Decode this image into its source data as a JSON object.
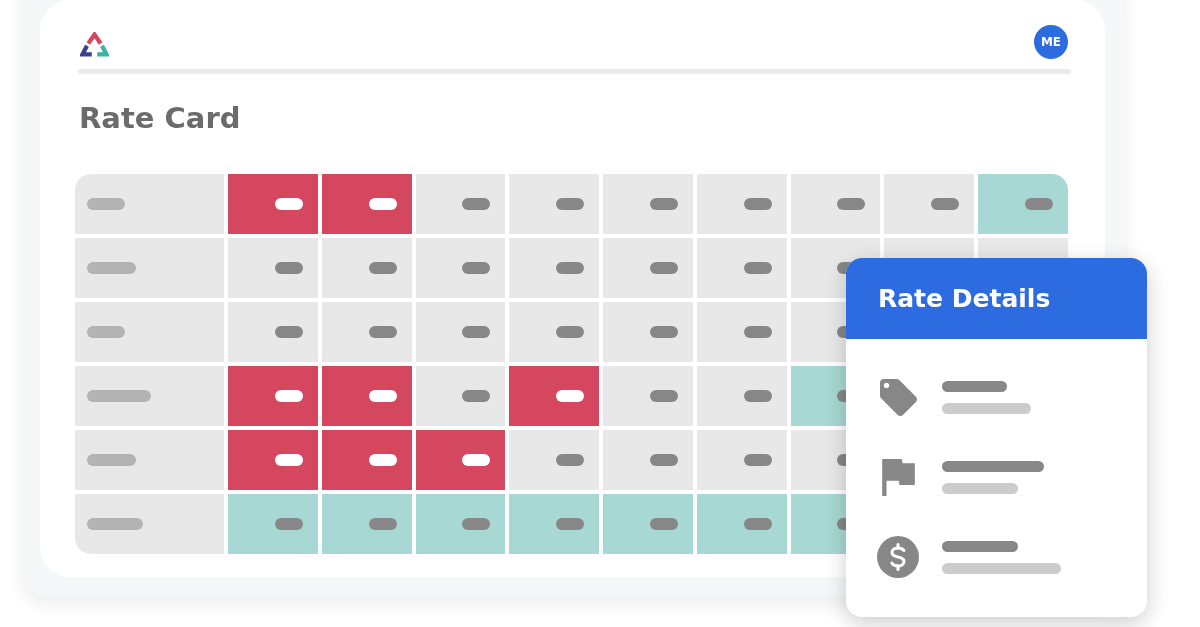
{
  "header": {
    "avatar": {
      "initials": "ME"
    }
  },
  "title": "Rate Card",
  "rate_grid": {
    "rows": [
      {
        "cells": [
          {
            "kind": "value",
            "color": "#d4475f"
          },
          {
            "kind": "value",
            "color": "#d4475f"
          },
          {
            "kind": "value",
            "color": "#e8e8e8"
          },
          {
            "kind": "value",
            "color": "#e8e8e8"
          },
          {
            "kind": "value",
            "color": "#e8e8e8"
          },
          {
            "kind": "value",
            "color": "#e8e8e8"
          },
          {
            "kind": "value",
            "color": "#e8e8e8"
          },
          {
            "kind": "value",
            "color": "#e8e8e8"
          },
          {
            "kind": "value",
            "color": "#a8d8d3"
          }
        ]
      },
      {
        "cells": [
          {
            "kind": "value",
            "color": "#e8e8e8"
          },
          {
            "kind": "value",
            "color": "#e8e8e8"
          },
          {
            "kind": "value",
            "color": "#e8e8e8"
          },
          {
            "kind": "value",
            "color": "#e8e8e8"
          },
          {
            "kind": "value",
            "color": "#e8e8e8"
          },
          {
            "kind": "value",
            "color": "#e8e8e8"
          },
          {
            "kind": "value",
            "color": "#e8e8e8"
          },
          {
            "kind": "blank",
            "color": "#e8e8e8"
          },
          {
            "kind": "blank",
            "color": "#e8e8e8"
          }
        ]
      },
      {
        "cells": [
          {
            "kind": "value",
            "color": "#e8e8e8"
          },
          {
            "kind": "value",
            "color": "#e8e8e8"
          },
          {
            "kind": "value",
            "color": "#e8e8e8"
          },
          {
            "kind": "value",
            "color": "#e8e8e8"
          },
          {
            "kind": "value",
            "color": "#e8e8e8"
          },
          {
            "kind": "value",
            "color": "#e8e8e8"
          },
          {
            "kind": "value",
            "color": "#e8e8e8"
          }
        ]
      },
      {
        "cells": [
          {
            "kind": "value",
            "color": "#d4475f"
          },
          {
            "kind": "value",
            "color": "#d4475f"
          },
          {
            "kind": "value",
            "color": "#e8e8e8"
          },
          {
            "kind": "value",
            "color": "#d4475f"
          },
          {
            "kind": "value",
            "color": "#e8e8e8"
          },
          {
            "kind": "value",
            "color": "#e8e8e8"
          },
          {
            "kind": "value",
            "color": "#a8d8d3"
          }
        ]
      },
      {
        "cells": [
          {
            "kind": "value",
            "color": "#d4475f"
          },
          {
            "kind": "value",
            "color": "#d4475f"
          },
          {
            "kind": "value",
            "color": "#d4475f"
          },
          {
            "kind": "value",
            "color": "#e8e8e8"
          },
          {
            "kind": "value",
            "color": "#e8e8e8"
          },
          {
            "kind": "value",
            "color": "#e8e8e8"
          },
          {
            "kind": "value",
            "color": "#e8e8e8"
          }
        ]
      },
      {
        "cells": [
          {
            "kind": "value",
            "color": "#a8d8d3"
          },
          {
            "kind": "value",
            "color": "#a8d8d3"
          },
          {
            "kind": "value",
            "color": "#a8d8d3"
          },
          {
            "kind": "value",
            "color": "#a8d8d3"
          },
          {
            "kind": "value",
            "color": "#a8d8d3"
          },
          {
            "kind": "value",
            "color": "#a8d8d3"
          },
          {
            "kind": "value",
            "color": "#a8d8d3"
          }
        ]
      }
    ]
  },
  "rate_details": {
    "title": "Rate Details",
    "items": [
      {
        "kind": "tag"
      },
      {
        "kind": "flag"
      },
      {
        "kind": "price"
      }
    ]
  }
}
